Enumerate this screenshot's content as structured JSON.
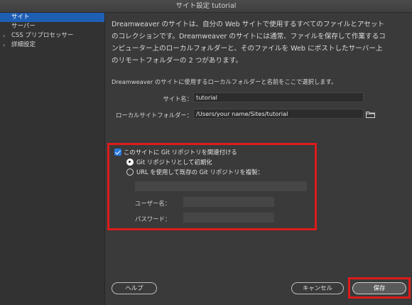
{
  "window": {
    "title": "サイト設定 tutorial"
  },
  "sidebar": {
    "items": [
      {
        "label": "サイト",
        "selected": true,
        "expandable": false
      },
      {
        "label": "サーバー",
        "selected": false,
        "expandable": false
      },
      {
        "label": "CSS プリプロセッサー",
        "selected": false,
        "expandable": true
      },
      {
        "label": "詳細設定",
        "selected": false,
        "expandable": true
      }
    ]
  },
  "intro": {
    "lines": [
      "Dreamweaver のサイトは、自分の Web サイトで使用するすべてのファイルとアセット",
      "のコレクションです。Dreamweaver のサイトには通常、ファイルを保存して作業するコ",
      "ンピューター上のローカルフォルダーと、そのファイルを Web にポストしたサーバー上",
      "のリモートフォルダーの 2 つがあります。"
    ]
  },
  "form": {
    "caption": "Dreamweaver のサイトに使用するローカルフォルダーと名前をここで選択します。",
    "site_name_label": "サイト名：",
    "site_name_value": "tutorial",
    "local_folder_label": "ローカルサイトフォルダー：",
    "local_folder_value": "/Users/your name/Sites/tutorial",
    "folder_icon": "folder-icon"
  },
  "git": {
    "checkbox_label": "このサイトに Git リポジトリを関連付ける",
    "checked": true,
    "option_init": "Git リポジトリとして初期化",
    "option_clone": "URL を使用して既存の Git リポジトリを複製：",
    "selected_option": "init",
    "url_value": "",
    "username_label": "ユーザー名：",
    "username_value": "",
    "password_label": "パスワード：",
    "password_value": ""
  },
  "buttons": {
    "help": "ヘルプ",
    "cancel": "キャンセル",
    "save": "保存"
  },
  "colors": {
    "highlight_red": "#dd1b1b",
    "selection_blue": "#1f5fb3",
    "checkbox_blue": "#2a7ae0"
  }
}
